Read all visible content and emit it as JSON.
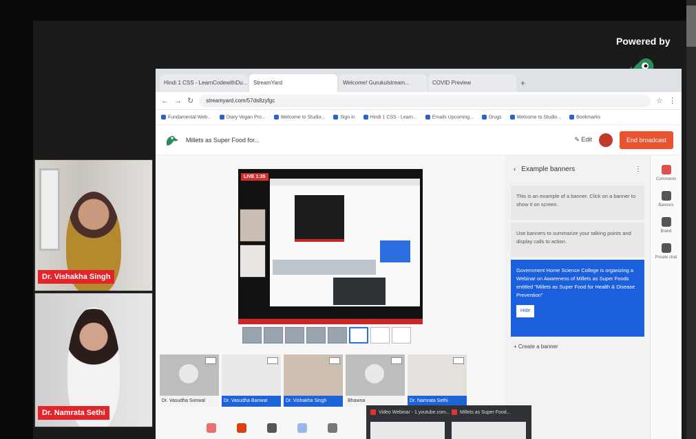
{
  "overlay": {
    "powered_by": "Powered by"
  },
  "participants": [
    {
      "name": "Dr. Vishakha Singh"
    },
    {
      "name": "Dr. Namrata Sethi"
    }
  ],
  "browser": {
    "tabs": [
      "Hindi 1 CSS - LearnCodewithDu...",
      "StreamYard",
      "Welcome! Gurukulstream...",
      "COVID Preview"
    ],
    "url": "streamyard.com/57ds8zyfgc",
    "bookmarks": [
      "Fundamental Web...",
      "Diary Vegan Pro...",
      "Welcome to Studio...",
      "Sign in",
      "Hindi 1 CSS - Learn...",
      "Emails Upcoming...",
      "Drugs",
      "Welcome to Studio...",
      "Bookmarks"
    ]
  },
  "app": {
    "title": "Millets as Super Food for...",
    "edit_label": "✎ Edit",
    "end_button": "End broadcast",
    "live_badge": "LIVE 1:35",
    "ticker_text": "Government Home Science College is organizing a Webinar..."
  },
  "thumbnails": [
    {
      "label": "Dr. Vasudha Sonwal",
      "highlighted": false
    },
    {
      "label": "Dr. Vasudha Banwat",
      "highlighted": true
    },
    {
      "label": "Dr. Vishakha Singh",
      "highlighted": true
    },
    {
      "label": "Bhawna",
      "highlighted": false
    },
    {
      "label": "Dr. Namrata Sethi",
      "highlighted": true
    }
  ],
  "sidebar": {
    "header": "Example banners",
    "banners": [
      "This is an example of a banner. Click on a banner to show it on screen.",
      "Use banners to summarize your talking points and display calls to action.",
      "Government Home Science College is organizing a Webinar on Awareness of Millets as Super Foods entitled \"Millets as Super Food for Health & Disease Prevention\""
    ],
    "hide_label": "Hide",
    "create_label": "+ Create a banner",
    "rail": [
      "Comments",
      "Banners",
      "Brand",
      "Private chat"
    ]
  },
  "taskbar": {
    "items": [
      "Video Webinar - 1.youtube.com...",
      "Millets as Super Food..."
    ]
  }
}
